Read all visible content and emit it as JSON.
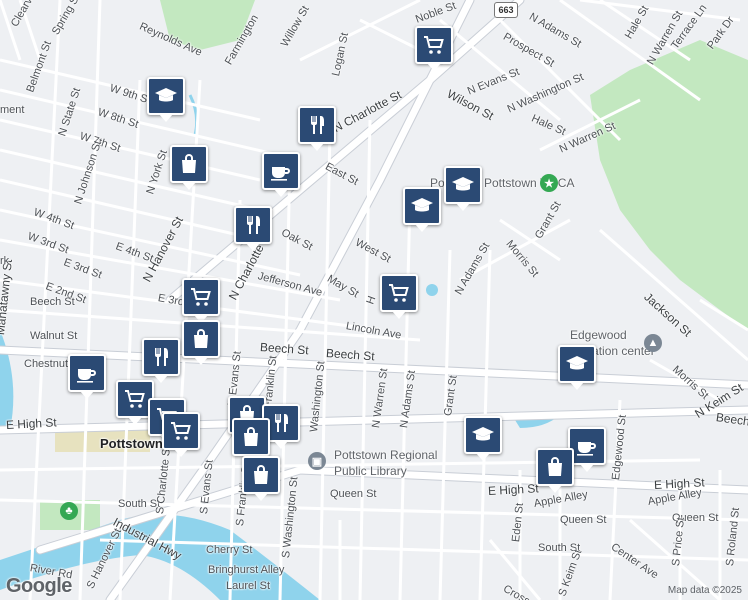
{
  "map": {
    "route_shield": "663",
    "attribution": "Map data ©2025",
    "logo": "Google",
    "colors": {
      "background": "#eef0f3",
      "water": "#8fd3ec",
      "park": "#c3e8c0",
      "road": "#ffffff",
      "road_border": "#c9ced6",
      "pin": "#2b4a74"
    }
  },
  "streets": [
    "Clearview St",
    "Spring St",
    "Reynolds Ave",
    "Farmington",
    "Willow St",
    "Logan St",
    "Belmont St",
    "W 9th St",
    "W 8th St",
    "W 7th St",
    "N State St",
    "N Johnson St",
    "N York St",
    "N Hanover St",
    "N Charlotte St",
    "N Charlotte St",
    "East St",
    "Oak St",
    "West St",
    "W 4th St",
    "W 3rd St",
    "E 4th St",
    "E 3rd St",
    "E 2nd St",
    "E 3rd",
    "Jefferson Ave",
    "May St",
    "Lincoln Ave",
    "Beech St",
    "Beech St",
    "Beech St",
    "Walnut St",
    "Chestnut",
    "N Evans St",
    "Franklin St",
    "Washington St",
    "N Warren St",
    "N Adams St",
    "Grant St",
    "E High St",
    "E High St",
    "E High St",
    "Queen St",
    "Queen St",
    "South St",
    "South St",
    "S Evans St",
    "S Charlotte St",
    "S Hanover St",
    "S Franklin St",
    "S Washington St",
    "Industrial Hwy",
    "River Rd",
    "Cherry St",
    "Bringhurst Alley",
    "Laurel St",
    "Manatawny St",
    "Wilson St",
    "N Evans St",
    "Prospect St",
    "N Washington St",
    "Hale St",
    "N Warren St",
    "N Adams St",
    "Grant St",
    "Morris St",
    "Jackson St",
    "Morris St",
    "N Keim St",
    "Beech",
    "Edgewood St",
    "Eden St",
    "Apple Alley",
    "Apple Alley",
    "Queen St",
    "Center Ave",
    "S Price St",
    "S Roland St",
    "S Keim St",
    "Cross",
    "Terrace Ln",
    "Park Dr",
    "Hale St",
    "N Warren St",
    "N Adams St",
    "Noble St",
    "ment",
    "rk",
    "H"
  ],
  "places": {
    "ymca": "Pottstown YMCA",
    "ymca_partial": "Po",
    "edgewood": "Edgewood",
    "edgewood2": "education center",
    "library1": "Pottstown Regional",
    "library2": "Public Library",
    "city": "Pottstown"
  },
  "markers": [
    {
      "type": "shopping-cart"
    },
    {
      "type": "school"
    },
    {
      "type": "shopping-bag"
    },
    {
      "type": "restaurant"
    },
    {
      "type": "cafe"
    },
    {
      "type": "school"
    },
    {
      "type": "school"
    },
    {
      "type": "restaurant"
    },
    {
      "type": "shopping-cart"
    },
    {
      "type": "shopping-cart"
    },
    {
      "type": "shopping-bag"
    },
    {
      "type": "restaurant"
    },
    {
      "type": "cafe"
    },
    {
      "type": "shopping-cart"
    },
    {
      "type": "shopping-cart"
    },
    {
      "type": "shopping-cart"
    },
    {
      "type": "shopping-bag"
    },
    {
      "type": "restaurant"
    },
    {
      "type": "shopping-bag"
    },
    {
      "type": "shopping-bag"
    },
    {
      "type": "school"
    },
    {
      "type": "school"
    },
    {
      "type": "cafe"
    },
    {
      "type": "shopping-bag"
    }
  ]
}
